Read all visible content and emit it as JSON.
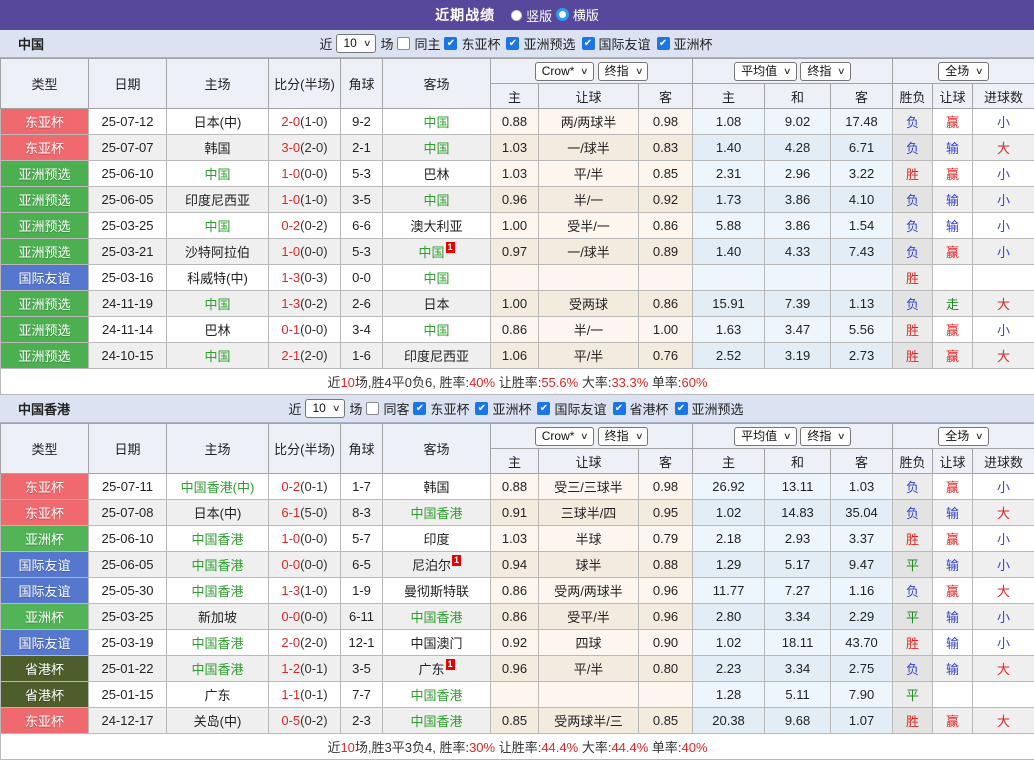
{
  "topbar": {
    "title": "近期战绩",
    "radios": [
      {
        "label": "竖版",
        "checked": false
      },
      {
        "label": "横版",
        "checked": true
      }
    ]
  },
  "colors": {
    "topbar_bg": "#57489c",
    "accent_red": "#e02626",
    "tracked_team_green": "#2f9e2f",
    "checkbox_blue": "#1b74e8",
    "type": {
      "东亚杯": "#f0696e",
      "亚洲预选": "#4cb050",
      "国际友谊": "#5577cd",
      "亚洲杯": "#53b357",
      "省港杯": "#4e5e2a"
    },
    "result": {
      "胜": "#e02626",
      "负": "#3344cc",
      "平": "#1f8a1f",
      "赢": "#e02626",
      "输": "#3344cc",
      "走": "#1f8a1f",
      "大": "#e02626",
      "小": "#3344cc"
    }
  },
  "columns": {
    "main": [
      "类型",
      "日期",
      "主场",
      "比分(半场)",
      "角球",
      "客场"
    ],
    "sub": [
      "主",
      "让球",
      "客",
      "主",
      "和",
      "客",
      "胜负",
      "让球",
      "进球数"
    ],
    "groups": [
      {
        "selects": [
          "Crow*",
          "终指"
        ]
      },
      {
        "selects": [
          "平均值",
          "终指"
        ]
      },
      {
        "selects": [
          "全场"
        ]
      }
    ]
  },
  "sections": [
    {
      "team": "中国",
      "filter": {
        "near": "近",
        "count": "10",
        "games": "场",
        "same_label": "同主",
        "same_checked": false,
        "leagues": [
          "东亚杯",
          "亚洲预选",
          "国际友谊",
          "亚洲杯"
        ]
      },
      "rows": [
        {
          "type": "东亚杯",
          "date": "25-07-12",
          "home": "日本(中)",
          "home_tracked": false,
          "home_badge": "",
          "score": "2-0",
          "half": "(1-0)",
          "corners": "9-2",
          "away": "中国",
          "away_tracked": true,
          "away_badge": "",
          "odds": [
            "0.88",
            "两/两球半",
            "0.98"
          ],
          "avg": [
            "1.08",
            "9.02",
            "17.48"
          ],
          "results": [
            "负",
            "赢",
            "小"
          ]
        },
        {
          "type": "东亚杯",
          "date": "25-07-07",
          "home": "韩国",
          "home_tracked": false,
          "home_badge": "",
          "score": "3-0",
          "half": "(2-0)",
          "corners": "2-1",
          "away": "中国",
          "away_tracked": true,
          "away_badge": "",
          "odds": [
            "1.03",
            "一/球半",
            "0.83"
          ],
          "avg": [
            "1.40",
            "4.28",
            "6.71"
          ],
          "results": [
            "负",
            "输",
            "大"
          ]
        },
        {
          "type": "亚洲预选",
          "date": "25-06-10",
          "home": "中国",
          "home_tracked": true,
          "home_badge": "",
          "score": "1-0",
          "half": "(0-0)",
          "corners": "5-3",
          "away": "巴林",
          "away_tracked": false,
          "away_badge": "",
          "odds": [
            "1.03",
            "平/半",
            "0.85"
          ],
          "avg": [
            "2.31",
            "2.96",
            "3.22"
          ],
          "results": [
            "胜",
            "赢",
            "小"
          ]
        },
        {
          "type": "亚洲预选",
          "date": "25-06-05",
          "home": "印度尼西亚",
          "home_tracked": false,
          "home_badge": "",
          "score": "1-0",
          "half": "(1-0)",
          "corners": "3-5",
          "away": "中国",
          "away_tracked": true,
          "away_badge": "",
          "odds": [
            "0.96",
            "半/一",
            "0.92"
          ],
          "avg": [
            "1.73",
            "3.86",
            "4.10"
          ],
          "results": [
            "负",
            "输",
            "小"
          ]
        },
        {
          "type": "亚洲预选",
          "date": "25-03-25",
          "home": "中国",
          "home_tracked": true,
          "home_badge": "",
          "score": "0-2",
          "half": "(0-2)",
          "corners": "6-6",
          "away": "澳大利亚",
          "away_tracked": false,
          "away_badge": "",
          "odds": [
            "1.00",
            "受半/一",
            "0.86"
          ],
          "avg": [
            "5.88",
            "3.86",
            "1.54"
          ],
          "results": [
            "负",
            "输",
            "小"
          ]
        },
        {
          "type": "亚洲预选",
          "date": "25-03-21",
          "home": "沙特阿拉伯",
          "home_tracked": false,
          "home_badge": "",
          "score": "1-0",
          "half": "(0-0)",
          "corners": "5-3",
          "away": "中国",
          "away_tracked": true,
          "away_badge": "1",
          "odds": [
            "0.97",
            "一/球半",
            "0.89"
          ],
          "avg": [
            "1.40",
            "4.33",
            "7.43"
          ],
          "results": [
            "负",
            "赢",
            "小"
          ]
        },
        {
          "type": "国际友谊",
          "date": "25-03-16",
          "home": "科威特(中)",
          "home_tracked": false,
          "home_badge": "",
          "score": "1-3",
          "half": "(0-3)",
          "corners": "0-0",
          "away": "中国",
          "away_tracked": true,
          "away_badge": "",
          "odds": [
            "",
            "",
            ""
          ],
          "avg": [
            "",
            "",
            ""
          ],
          "results": [
            "胜",
            "",
            ""
          ]
        },
        {
          "type": "亚洲预选",
          "date": "24-11-19",
          "home": "中国",
          "home_tracked": true,
          "home_badge": "",
          "score": "1-3",
          "half": "(0-2)",
          "corners": "2-6",
          "away": "日本",
          "away_tracked": false,
          "away_badge": "",
          "odds": [
            "1.00",
            "受两球",
            "0.86"
          ],
          "avg": [
            "15.91",
            "7.39",
            "1.13"
          ],
          "results": [
            "负",
            "走",
            "大"
          ]
        },
        {
          "type": "亚洲预选",
          "date": "24-11-14",
          "home": "巴林",
          "home_tracked": false,
          "home_badge": "",
          "score": "0-1",
          "half": "(0-0)",
          "corners": "3-4",
          "away": "中国",
          "away_tracked": true,
          "away_badge": "",
          "odds": [
            "0.86",
            "半/一",
            "1.00"
          ],
          "avg": [
            "1.63",
            "3.47",
            "5.56"
          ],
          "results": [
            "胜",
            "赢",
            "小"
          ]
        },
        {
          "type": "亚洲预选",
          "date": "24-10-15",
          "home": "中国",
          "home_tracked": true,
          "home_badge": "",
          "score": "2-1",
          "half": "(2-0)",
          "corners": "1-6",
          "away": "印度尼西亚",
          "away_tracked": false,
          "away_badge": "",
          "odds": [
            "1.06",
            "平/半",
            "0.76"
          ],
          "avg": [
            "2.52",
            "3.19",
            "2.73"
          ],
          "results": [
            "胜",
            "赢",
            "大"
          ]
        }
      ],
      "summary": [
        {
          "t": "近"
        },
        {
          "t": "10",
          "red": true
        },
        {
          "t": "场,胜4平0负6, 胜率:"
        },
        {
          "t": "40%",
          "red": true
        },
        {
          "t": " 让胜率:"
        },
        {
          "t": "55.6%",
          "red": true
        },
        {
          "t": " 大率:"
        },
        {
          "t": "33.3%",
          "red": true
        },
        {
          "t": " 单率:"
        },
        {
          "t": "60%",
          "red": true
        }
      ]
    },
    {
      "team": "中国香港",
      "filter": {
        "near": "近",
        "count": "10",
        "games": "场",
        "same_label": "同客",
        "same_checked": false,
        "leagues": [
          "东亚杯",
          "亚洲杯",
          "国际友谊",
          "省港杯",
          "亚洲预选"
        ]
      },
      "rows": [
        {
          "type": "东亚杯",
          "date": "25-07-11",
          "home": "中国香港(中)",
          "home_tracked": true,
          "home_badge": "",
          "score": "0-2",
          "half": "(0-1)",
          "corners": "1-7",
          "away": "韩国",
          "away_tracked": false,
          "away_badge": "",
          "odds": [
            "0.88",
            "受三/三球半",
            "0.98"
          ],
          "avg": [
            "26.92",
            "13.11",
            "1.03"
          ],
          "results": [
            "负",
            "赢",
            "小"
          ]
        },
        {
          "type": "东亚杯",
          "date": "25-07-08",
          "home": "日本(中)",
          "home_tracked": false,
          "home_badge": "",
          "score": "6-1",
          "half": "(5-0)",
          "corners": "8-3",
          "away": "中国香港",
          "away_tracked": true,
          "away_badge": "",
          "odds": [
            "0.91",
            "三球半/四",
            "0.95"
          ],
          "avg": [
            "1.02",
            "14.83",
            "35.04"
          ],
          "results": [
            "负",
            "输",
            "大"
          ]
        },
        {
          "type": "亚洲杯",
          "date": "25-06-10",
          "home": "中国香港",
          "home_tracked": true,
          "home_badge": "",
          "score": "1-0",
          "half": "(0-0)",
          "corners": "5-7",
          "away": "印度",
          "away_tracked": false,
          "away_badge": "",
          "odds": [
            "1.03",
            "半球",
            "0.79"
          ],
          "avg": [
            "2.18",
            "2.93",
            "3.37"
          ],
          "results": [
            "胜",
            "赢",
            "小"
          ]
        },
        {
          "type": "国际友谊",
          "date": "25-06-05",
          "home": "中国香港",
          "home_tracked": true,
          "home_badge": "",
          "score": "0-0",
          "half": "(0-0)",
          "corners": "6-5",
          "away": "尼泊尔",
          "away_tracked": false,
          "away_badge": "1",
          "odds": [
            "0.94",
            "球半",
            "0.88"
          ],
          "avg": [
            "1.29",
            "5.17",
            "9.47"
          ],
          "results": [
            "平",
            "输",
            "小"
          ]
        },
        {
          "type": "国际友谊",
          "date": "25-05-30",
          "home": "中国香港",
          "home_tracked": true,
          "home_badge": "",
          "score": "1-3",
          "half": "(1-0)",
          "corners": "1-9",
          "away": "曼彻斯特联",
          "away_tracked": false,
          "away_badge": "",
          "odds": [
            "0.86",
            "受两/两球半",
            "0.96"
          ],
          "avg": [
            "11.77",
            "7.27",
            "1.16"
          ],
          "results": [
            "负",
            "赢",
            "大"
          ]
        },
        {
          "type": "亚洲杯",
          "date": "25-03-25",
          "home": "新加坡",
          "home_tracked": false,
          "home_badge": "",
          "score": "0-0",
          "half": "(0-0)",
          "corners": "6-11",
          "away": "中国香港",
          "away_tracked": true,
          "away_badge": "",
          "odds": [
            "0.86",
            "受平/半",
            "0.96"
          ],
          "avg": [
            "2.80",
            "3.34",
            "2.29"
          ],
          "results": [
            "平",
            "输",
            "小"
          ]
        },
        {
          "type": "国际友谊",
          "date": "25-03-19",
          "home": "中国香港",
          "home_tracked": true,
          "home_badge": "",
          "score": "2-0",
          "half": "(2-0)",
          "corners": "12-1",
          "away": "中国澳门",
          "away_tracked": false,
          "away_badge": "",
          "odds": [
            "0.92",
            "四球",
            "0.90"
          ],
          "avg": [
            "1.02",
            "18.11",
            "43.70"
          ],
          "results": [
            "胜",
            "输",
            "小"
          ]
        },
        {
          "type": "省港杯",
          "date": "25-01-22",
          "home": "中国香港",
          "home_tracked": true,
          "home_badge": "",
          "score": "1-2",
          "half": "(0-1)",
          "corners": "3-5",
          "away": "广东",
          "away_tracked": false,
          "away_badge": "1",
          "odds": [
            "0.96",
            "平/半",
            "0.80"
          ],
          "avg": [
            "2.23",
            "3.34",
            "2.75"
          ],
          "results": [
            "负",
            "输",
            "大"
          ]
        },
        {
          "type": "省港杯",
          "date": "25-01-15",
          "home": "广东",
          "home_tracked": false,
          "home_badge": "",
          "score": "1-1",
          "half": "(0-1)",
          "corners": "7-7",
          "away": "中国香港",
          "away_tracked": true,
          "away_badge": "",
          "odds": [
            "",
            "",
            ""
          ],
          "avg": [
            "1.28",
            "5.11",
            "7.90"
          ],
          "results": [
            "平",
            "",
            ""
          ]
        },
        {
          "type": "东亚杯",
          "date": "24-12-17",
          "home": "关岛(中)",
          "home_tracked": false,
          "home_badge": "",
          "score": "0-5",
          "half": "(0-2)",
          "corners": "2-3",
          "away": "中国香港",
          "away_tracked": true,
          "away_badge": "",
          "odds": [
            "0.85",
            "受两球半/三",
            "0.85"
          ],
          "avg": [
            "20.38",
            "9.68",
            "1.07"
          ],
          "results": [
            "胜",
            "赢",
            "大"
          ]
        }
      ],
      "summary": [
        {
          "t": "近"
        },
        {
          "t": "10",
          "red": true
        },
        {
          "t": "场,胜3平3负4, 胜率:"
        },
        {
          "t": "30%",
          "red": true
        },
        {
          "t": " 让胜率:"
        },
        {
          "t": "44.4%",
          "red": true
        },
        {
          "t": " 大率:"
        },
        {
          "t": "44.4%",
          "red": true
        },
        {
          "t": " 单率:"
        },
        {
          "t": "40%",
          "red": true
        }
      ]
    }
  ]
}
